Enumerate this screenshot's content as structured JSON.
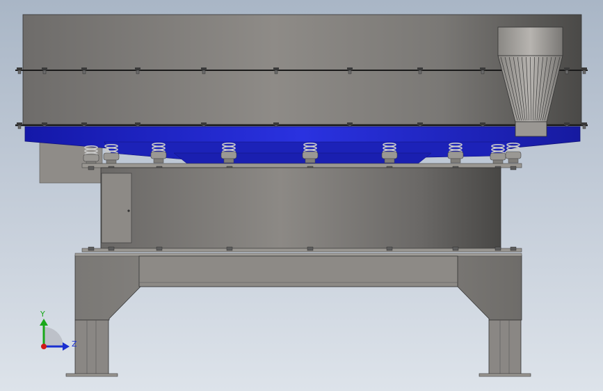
{
  "triad": {
    "y_label": "Y",
    "z_label": "Z",
    "y_color": "#1aa81a",
    "z_color": "#1a2fd0",
    "origin_color": "#d01818"
  },
  "colors": {
    "body_gray": "#7e7c78",
    "base_blue": "#1e24c8",
    "frame_gray": "#8a8885"
  }
}
